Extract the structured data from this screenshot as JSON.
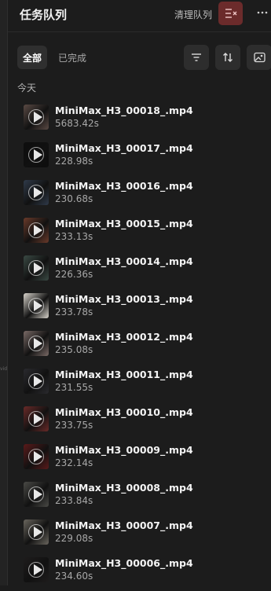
{
  "header": {
    "title": "任务队列",
    "clear_label": "清理队列"
  },
  "tabs": {
    "all": "全部",
    "completed": "已完成"
  },
  "section_label": "今天",
  "left_edge_text": "vid",
  "icons": {
    "clear": "clear-list-icon",
    "more": "more-horizontal-icon",
    "filter": "filter-icon",
    "sort": "sort-icon",
    "image": "image-icon"
  },
  "colors": {
    "background": "#1c1c1c",
    "accent_danger": "#6b2b2b"
  },
  "items": [
    {
      "name": "MiniMax_H3_00018_.mp4",
      "duration": "5683.42s",
      "thumb": "#5a4a44"
    },
    {
      "name": "MiniMax_H3_00017_.mp4",
      "duration": "228.98s",
      "thumb": "#0d0d0d"
    },
    {
      "name": "MiniMax_H3_00016_.mp4",
      "duration": "230.68s",
      "thumb": "#2f3a4a"
    },
    {
      "name": "MiniMax_H3_00015_.mp4",
      "duration": "233.13s",
      "thumb": "#6a3a2a"
    },
    {
      "name": "MiniMax_H3_00014_.mp4",
      "duration": "226.36s",
      "thumb": "#3a4a44"
    },
    {
      "name": "MiniMax_H3_00013_.mp4",
      "duration": "233.78s",
      "thumb": "#d8d4cc"
    },
    {
      "name": "MiniMax_H3_00012_.mp4",
      "duration": "235.08s",
      "thumb": "#7a6a66"
    },
    {
      "name": "MiniMax_H3_00011_.mp4",
      "duration": "231.55s",
      "thumb": "#2a2a2e"
    },
    {
      "name": "MiniMax_H3_00010_.mp4",
      "duration": "233.75s",
      "thumb": "#6a2a28"
    },
    {
      "name": "MiniMax_H3_00009_.mp4",
      "duration": "232.14s",
      "thumb": "#5a1a1a"
    },
    {
      "name": "MiniMax_H3_00008_.mp4",
      "duration": "233.84s",
      "thumb": "#4a4a46"
    },
    {
      "name": "MiniMax_H3_00007_.mp4",
      "duration": "229.08s",
      "thumb": "#6a665e"
    },
    {
      "name": "MiniMax_H3_00006_.mp4",
      "duration": "234.60s",
      "thumb": "#1e1c1c"
    }
  ]
}
